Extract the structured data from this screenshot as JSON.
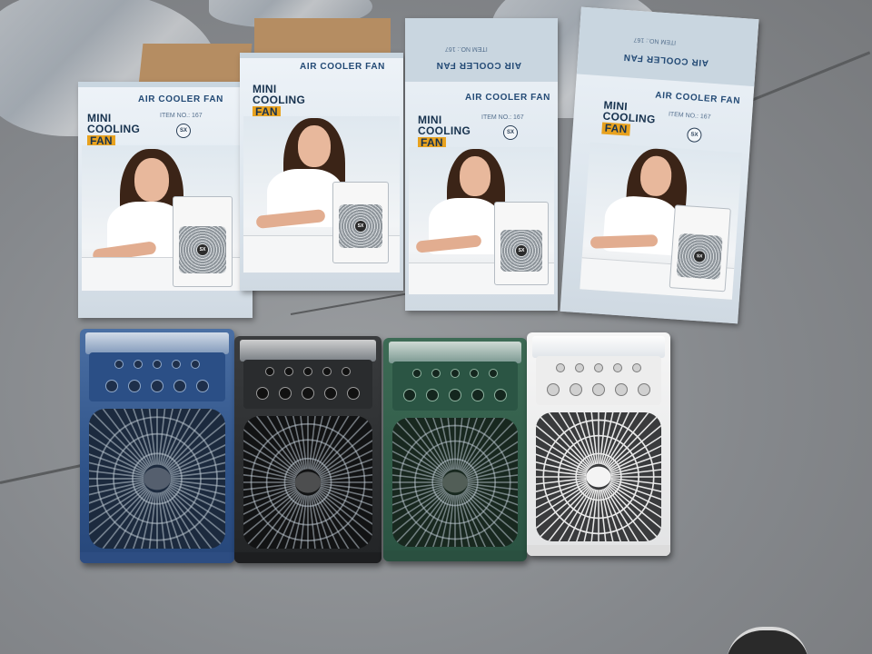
{
  "scene": {
    "description_free": true,
    "boxes": [
      {
        "brand_line1": "MINI",
        "brand_line2": "COOLING",
        "brand_line3": "FAN",
        "title": "AIR COOLER FAN",
        "item_no": "ITEM NO.: 167",
        "logo": "SX"
      },
      {
        "brand_line1": "MINI",
        "brand_line2": "COOLING",
        "brand_line3": "FAN",
        "title": "AIR COOLER FAN",
        "item_no": "",
        "logo": "SX"
      },
      {
        "brand_line1": "MINI",
        "brand_line2": "COOLING",
        "brand_line3": "FAN",
        "title": "AIR COOLER FAN",
        "item_no": "ITEM NO.: 167",
        "logo": "SX",
        "top_title": "AIR COOLER FAN",
        "top_item_no": "ITEM NO.: 167"
      },
      {
        "brand_line1": "MINI",
        "brand_line2": "COOLING",
        "brand_line3": "FAN",
        "title": "AIR COOLER FAN",
        "item_no": "ITEM NO.: 167",
        "logo": "SX",
        "top_title": "AIR COOLER FAN",
        "top_item_no": "ITEM NO.: 167"
      }
    ],
    "units": [
      {
        "color_name": "blue",
        "body_color": "#2f5389"
      },
      {
        "color_name": "black",
        "body_color": "#222426"
      },
      {
        "color_name": "green",
        "body_color": "#2a5342"
      },
      {
        "color_name": "white",
        "body_color": "#e8e8e8"
      }
    ],
    "icons": [
      "fan-grille-icon",
      "knob-icon",
      "sx-logo-icon"
    ]
  }
}
